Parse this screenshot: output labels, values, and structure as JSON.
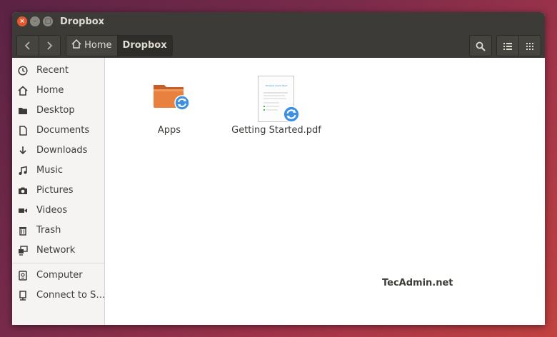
{
  "window": {
    "title": "Dropbox",
    "close_icon": "close-icon",
    "minimize_icon": "minimize-icon",
    "maximize_icon": "maximize-icon"
  },
  "toolbar": {
    "breadcrumb": [
      {
        "label": "Home",
        "icon": "home-icon"
      },
      {
        "label": "Dropbox"
      }
    ],
    "buttons": {
      "back": "chevron-left-icon",
      "forward": "chevron-right-icon",
      "search": "search-icon",
      "list_view": "list-view-icon",
      "grid_view": "grid-view-icon"
    }
  },
  "sidebar": {
    "places": [
      {
        "label": "Recent",
        "icon": "clock-icon"
      },
      {
        "label": "Home",
        "icon": "home-icon"
      },
      {
        "label": "Desktop",
        "icon": "folder-icon"
      },
      {
        "label": "Documents",
        "icon": "document-icon"
      },
      {
        "label": "Downloads",
        "icon": "download-icon"
      },
      {
        "label": "Music",
        "icon": "music-icon"
      },
      {
        "label": "Pictures",
        "icon": "camera-icon"
      },
      {
        "label": "Videos",
        "icon": "video-icon"
      },
      {
        "label": "Trash",
        "icon": "trash-icon"
      },
      {
        "label": "Network",
        "icon": "network-icon"
      }
    ],
    "devices": [
      {
        "label": "Computer",
        "icon": "computer-icon"
      },
      {
        "label": "Connect to S…",
        "icon": "server-icon"
      }
    ]
  },
  "files": [
    {
      "name": "Apps",
      "type": "folder",
      "sync_icon": "sync-icon"
    },
    {
      "name": "Getting Started.pdf",
      "type": "pdf",
      "sync_icon": "sync-icon",
      "thumbnail_heading": "Dropbox Quick Start"
    }
  ],
  "watermark": "TecAdmin.net",
  "colors": {
    "titlebar": "#3c3b37",
    "close_button": "#e3582f",
    "folder": "#e07a3a",
    "sync_badge": "#3d8fe0"
  }
}
